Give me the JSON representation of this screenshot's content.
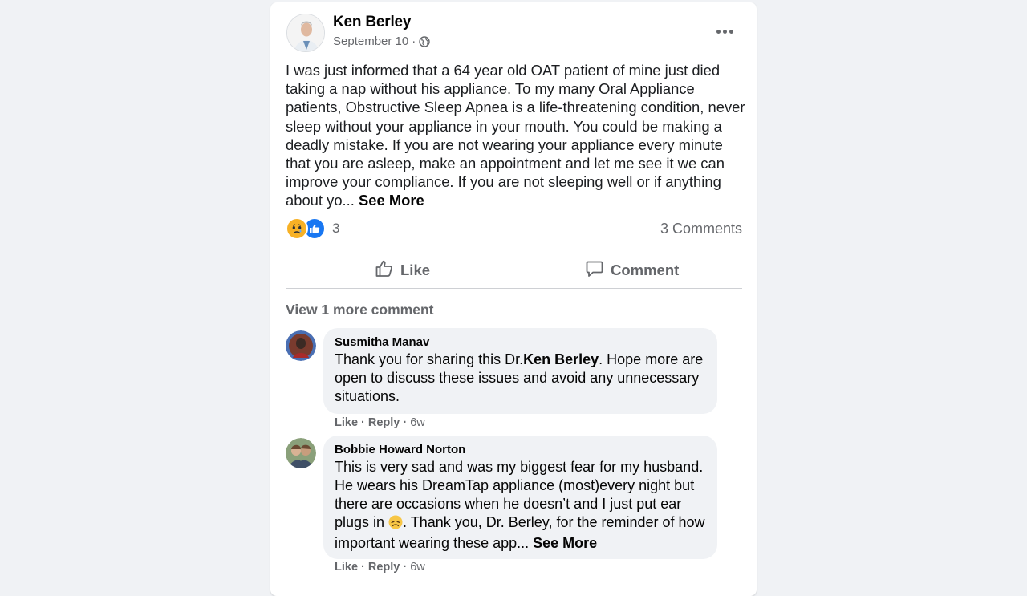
{
  "post": {
    "author": "Ken Berley",
    "date": "September 10",
    "dot": "·",
    "text": "I was just informed that a 64 year old OAT patient of mine just died taking a nap without his appliance. To my many Oral Appliance patients, Obstructive Sleep Apnea is a life-threatening condition, never sleep without your appliance in your mouth. You could be making a deadly mistake. If you are not wearing your appliance every minute that you are asleep, make an appointment and let me see it we can improve your compliance. If you are not sleeping well or if anything about yo... ",
    "see_more": "See More",
    "reaction_count": "3",
    "comments_count": "3 Comments"
  },
  "actions": {
    "like": "Like",
    "comment": "Comment"
  },
  "view_more_comments": "View 1 more comment",
  "comments": [
    {
      "name": "Susmitha Manav",
      "text_before": "Thank you for sharing this Dr.",
      "mention": "Ken Berley",
      "text_after": ". Hope more are open to discuss these issues and avoid any unnecessary situations.",
      "like": "Like",
      "reply": "Reply",
      "time": "6w"
    },
    {
      "name": "Bobbie Howard Norton",
      "text_before": "This is very sad and was my biggest fear for my husband. He wears his DreamTap appliance (most)every night but there are occasions when he doesn’t and I just put ear plugs in ",
      "text_after": ". Thank you, Dr. Berley, for the reminder of how important wearing these app... ",
      "see_more": "See More",
      "like": "Like",
      "reply": "Reply",
      "time": "6w"
    }
  ],
  "separator": "·",
  "colors": {
    "page_bg": "#f0f2f5",
    "card_bg": "#ffffff",
    "secondary_text": "#65676b",
    "like_blue": "#1877f2",
    "sad_yellow": "#f7b125",
    "bubble_bg": "#f0f2f5"
  },
  "icons": {
    "privacy": "globe-icon",
    "menu": "more-dots-icon",
    "like": "thumbs-up-icon",
    "comment": "speech-bubble-icon",
    "reaction_sad": "sad-face-icon",
    "reaction_like": "like-reaction-icon",
    "emoji": "tired-face-emoji"
  }
}
